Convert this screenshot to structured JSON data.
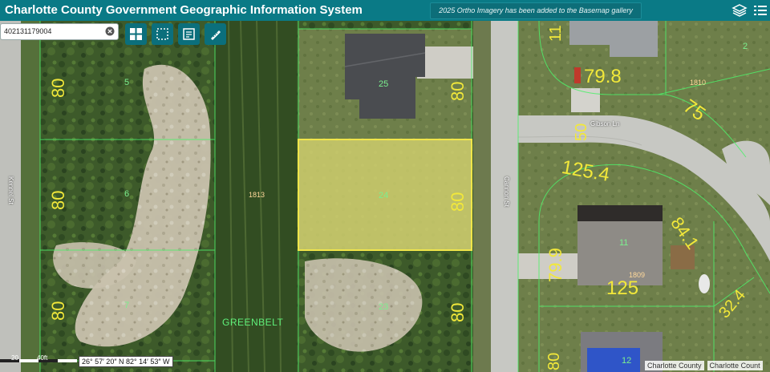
{
  "header": {
    "title": "Charlotte County Government Geographic Information System",
    "notice": "2025 Ortho Imagery has been added to the Basemap gallery",
    "icons": [
      "layers-icon",
      "legend-list-icon"
    ]
  },
  "search": {
    "value": "402131179004",
    "placeholder": ""
  },
  "toolbar": {
    "tools": [
      "basemap-gallery-icon",
      "select-area-icon",
      "print-icon",
      "measure-icon"
    ]
  },
  "map": {
    "parcel_numbers": [
      "5",
      "6",
      "7",
      "25",
      "24",
      "23",
      "2",
      "11",
      "12"
    ],
    "dimensions": [
      "80",
      "80",
      "80",
      "80",
      "80",
      "80",
      "79.8",
      "75",
      "50",
      "125.4",
      "84.1",
      "79.9",
      "125",
      "32.4",
      "80",
      "11"
    ],
    "block_labels": [
      "1813",
      "1810",
      "1809"
    ],
    "streets": [
      "Kennel St",
      "Cannon St",
      "Gibson Ln"
    ],
    "area_label": "GREENBELT",
    "selected_parcel": "24"
  },
  "status": {
    "coordinates": "26° 57′ 20″ N 82° 14′ 53″ W",
    "scale_labels": [
      "20",
      "40ft"
    ],
    "attribution": [
      "Charlotte County",
      "Charlotte Count"
    ]
  }
}
